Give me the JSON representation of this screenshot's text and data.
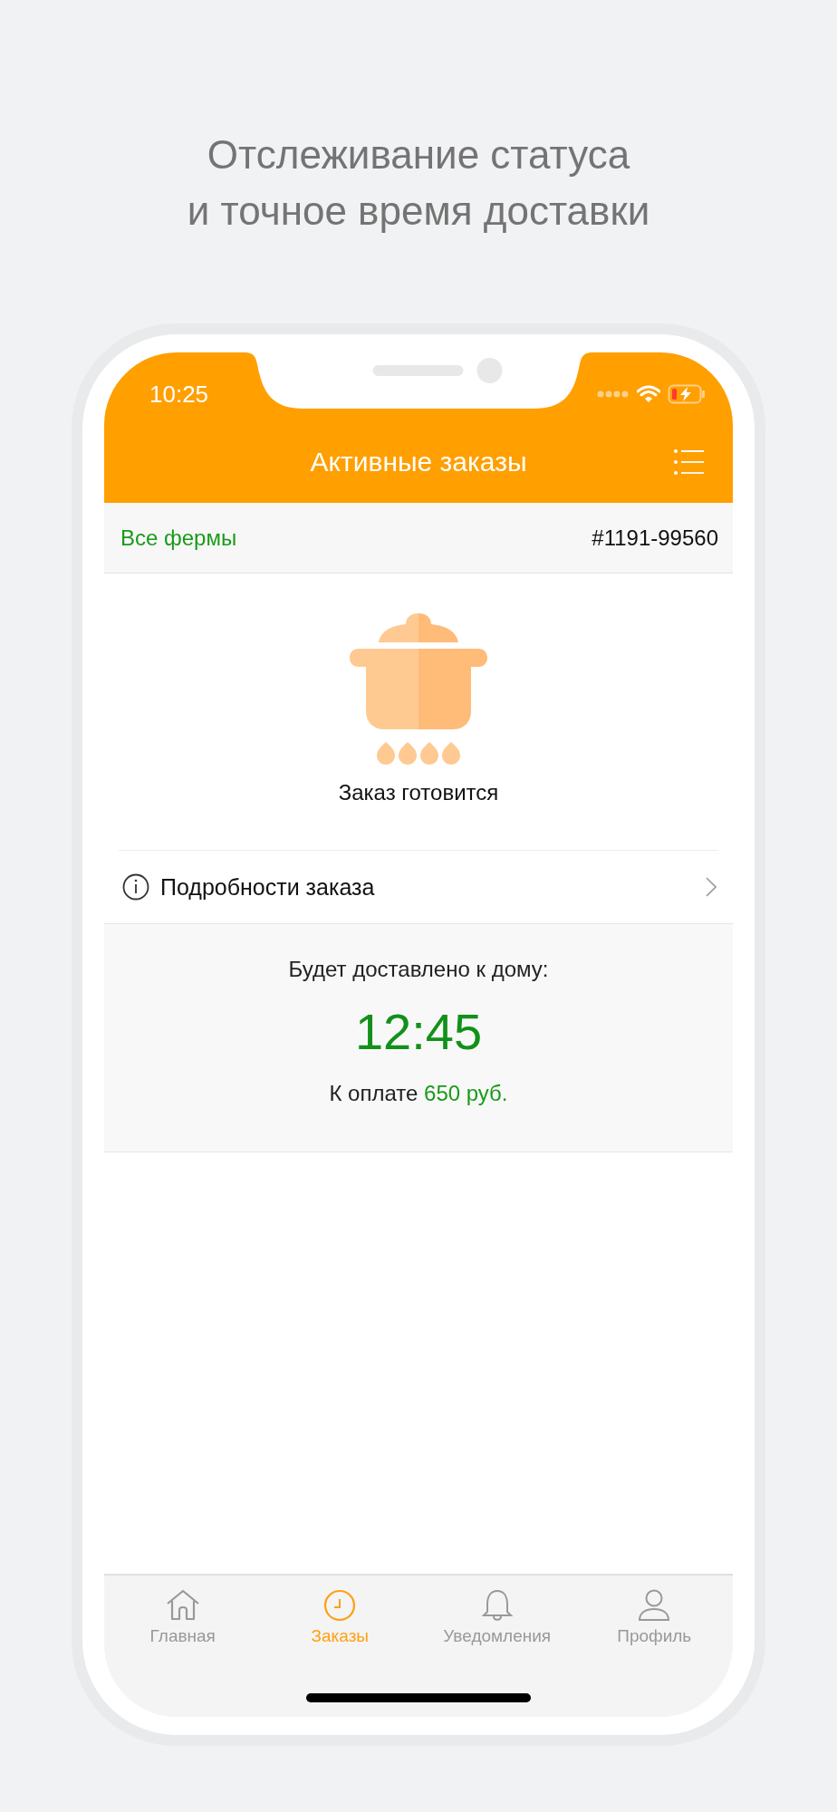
{
  "headline_lines": [
    "Отслеживание статуса",
    "и точное время доставки"
  ],
  "status_bar": {
    "time": "10:25"
  },
  "nav_bar": {
    "title": "Активные заказы"
  },
  "filter_bar": {
    "farm_filter": "Все фермы",
    "order_number": "#1191-99560"
  },
  "order_status": {
    "label": "Заказ готовится"
  },
  "details_link": {
    "label": "Подробности заказа"
  },
  "delivery": {
    "heading": "Будет доставлено к дому:",
    "time": "12:45",
    "payment_label": "К оплате",
    "amount": "650 руб."
  },
  "tabs": [
    {
      "label": "Главная",
      "selected": false
    },
    {
      "label": "Заказы",
      "selected": true
    },
    {
      "label": "Уведомления",
      "selected": false
    },
    {
      "label": "Профиль",
      "selected": false
    }
  ]
}
